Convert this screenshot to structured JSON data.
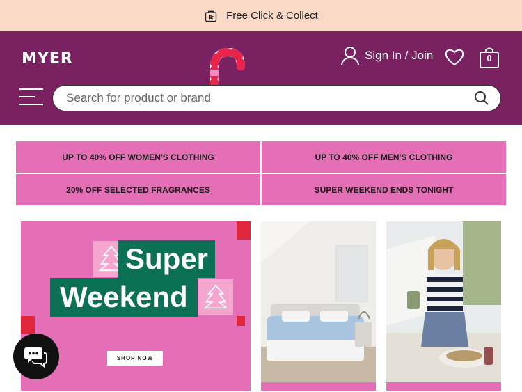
{
  "top_banner": {
    "text": "Free Click & Collect",
    "icon": "click-collect-icon"
  },
  "header": {
    "logo_text": "MYER",
    "sign_in_label": "Sign In / Join",
    "bag_count": "0",
    "search_placeholder": "Search for product or brand",
    "background": "#7a2161"
  },
  "promos": [
    {
      "label": "UP TO 40% OFF WOMEN'S CLOTHING"
    },
    {
      "label": "UP TO 40% OFF MEN'S CLOTHING"
    },
    {
      "label": "20% OFF SELECTED FRAGRANCES"
    },
    {
      "label": "SUPER WEEKEND ENDS TONIGHT"
    }
  ],
  "hero": {
    "title_line1": "Super",
    "title_line2": "Weekend",
    "cta_label": "SHOP NOW",
    "background": "#e46fb7",
    "accent": "#0c7057"
  },
  "colors": {
    "banner": "#fbd9c7",
    "promo": "#e46fb7"
  }
}
